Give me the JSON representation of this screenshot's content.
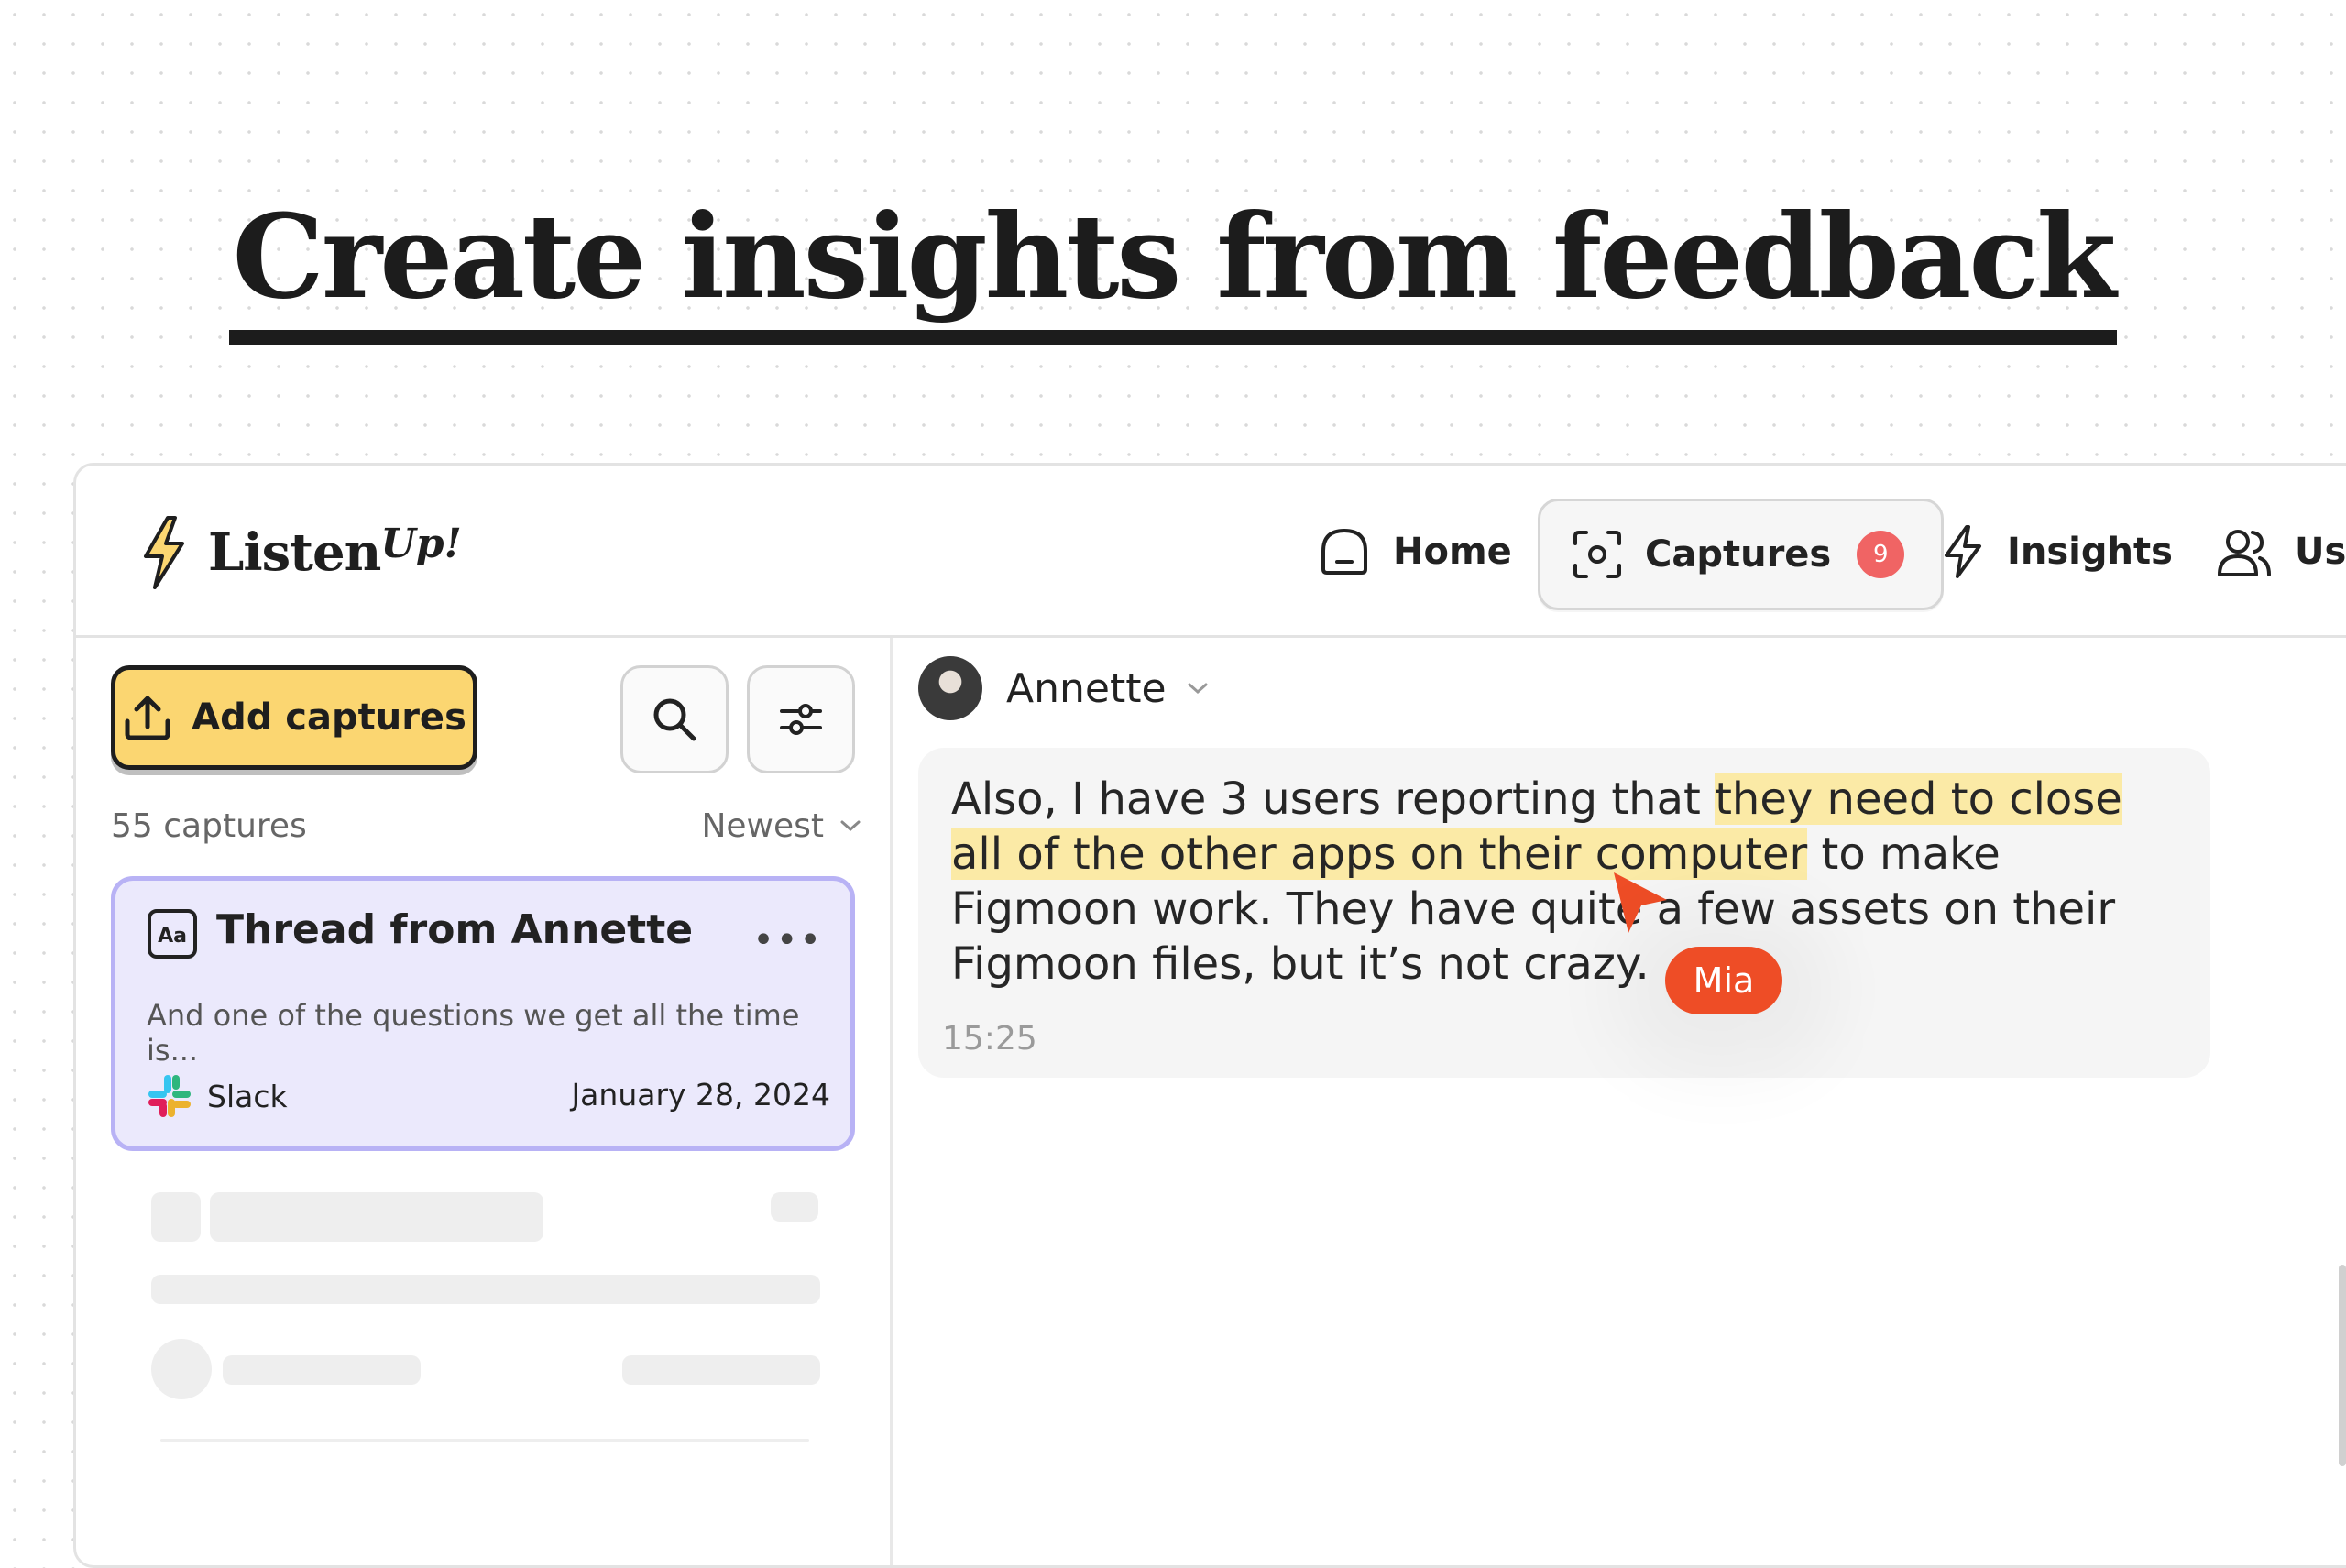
{
  "headline": "Create insights from feedback",
  "app": {
    "name": "Listen",
    "name_suffix": "Up!"
  },
  "nav": {
    "home": "Home",
    "captures": "Captures",
    "captures_badge": "9",
    "insights": "Insights",
    "users": "Users"
  },
  "sidebar": {
    "add_button": "Add captures",
    "count": "55 captures",
    "sort": "Newest"
  },
  "card": {
    "title": "Thread from Annette",
    "snippet": "And one of the questions we get all the time is...",
    "source": "Slack",
    "date": "January 28, 2024"
  },
  "message": {
    "author": "Annette",
    "text_before": "Also, I have 3 users reporting that ",
    "text_highlight": "they need to close all of the other apps on their computer",
    "text_after": " to make Figmoon work. They have quite a few assets on their Figmoon files, but it’s not crazy.",
    "time": "15:25"
  },
  "cursor": {
    "user": "Mia",
    "color": "#ee4d26"
  },
  "colors": {
    "accent": "#fbd671",
    "card_bg": "#ebe9fc",
    "card_border": "#b8b2f5",
    "highlight": "#fbeaa6",
    "badge": "#f06464"
  }
}
